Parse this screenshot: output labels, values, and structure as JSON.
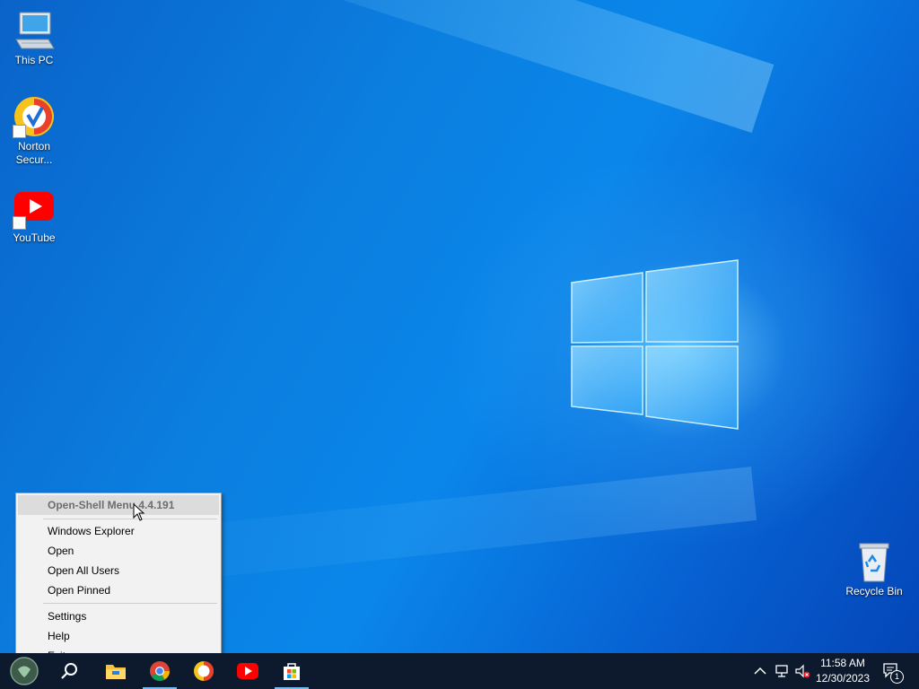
{
  "desktop": {
    "icons": [
      {
        "label": "This PC",
        "icon": "computer-icon"
      },
      {
        "label": "Norton Secur...",
        "icon": "norton-icon"
      },
      {
        "label": "YouTube",
        "icon": "youtube-icon"
      },
      {
        "label": "Recycle Bin",
        "icon": "recycle-bin-icon"
      }
    ]
  },
  "context_menu": {
    "header": "Open-Shell Menu 4.4.191",
    "items": [
      {
        "label": "Windows Explorer"
      },
      {
        "label": "Open"
      },
      {
        "label": "Open All Users"
      },
      {
        "label": "Open Pinned"
      },
      {
        "label": "Settings"
      },
      {
        "label": "Help"
      },
      {
        "label": "Exit",
        "mark": "x"
      }
    ]
  },
  "taskbar": {
    "buttons": [
      {
        "name": "start-button",
        "icon": "open-shell-icon"
      },
      {
        "name": "search-button",
        "icon": "search-icon"
      },
      {
        "name": "file-explorer-button",
        "icon": "folder-icon"
      },
      {
        "name": "chrome-button",
        "icon": "chrome-icon"
      },
      {
        "name": "norton-button",
        "icon": "norton-icon"
      },
      {
        "name": "youtube-button",
        "icon": "youtube-icon"
      },
      {
        "name": "store-button",
        "icon": "store-icon"
      }
    ],
    "tray": {
      "time": "11:58 AM",
      "date": "12/30/2023",
      "notification_count": "1"
    }
  },
  "colors": {
    "taskbar_bg": "#0d1a2e",
    "menu_bg": "#f2f2f2",
    "running_indicator": "#76b9ed",
    "desktop_blue": "#0b7fe0"
  }
}
